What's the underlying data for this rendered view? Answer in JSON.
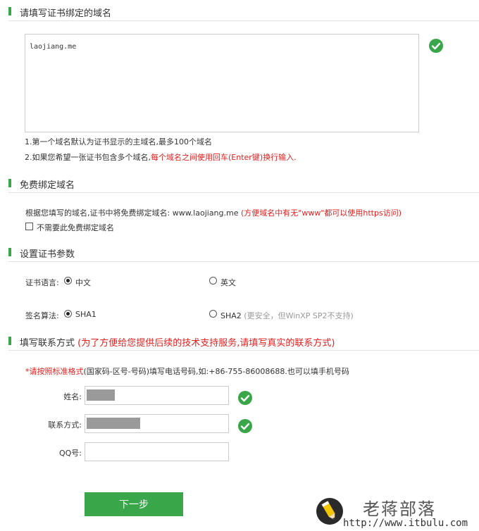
{
  "colors": {
    "accent": "#3aa64a",
    "alert": "#e02020"
  },
  "domain_section": {
    "title": "请填写证书绑定的域名",
    "domain_value": "laojiang.me",
    "valid_icon": "check-circle-icon",
    "hint1": "1.第一个域名默认为证书显示的主域名,最多100个域名",
    "hint2_prefix": "2.如果您希望一张证书包含多个域名,",
    "hint2_red": "每个域名之间使用回车(Enter键)换行输入."
  },
  "free_section": {
    "title": "免费绑定域名",
    "text_prefix": "根据您填写的域名,证书中将免费绑定域名: www.laojiang.me ",
    "text_red": "(方便域名中有无\"www\"都可以使用https访问)",
    "checkbox_label": "不需要此免费绑定域名",
    "checkbox_checked": false
  },
  "params_section": {
    "title": "设置证书参数",
    "language_label": "证书语言:",
    "language_options": [
      "中文",
      "英文"
    ],
    "language_selected": "中文",
    "algorithm_label": "签名算法:",
    "algorithm_options": [
      "SHA1",
      "SHA2"
    ],
    "algorithm_selected": "SHA1",
    "sha2_note": "(更安全，但WinXP SP2不支持)"
  },
  "contact_section": {
    "title": "填写联系方式",
    "title_note": "(为了方便给您提供后续的技术支持服务,请填写真实的联系方式)",
    "format_red": "*请按照标准格式",
    "format_text": "(国家码-区号-号码)填写电话号码,如:+86-755-86008688.也可以填手机号码",
    "name_label": "姓名:",
    "phone_label": "联系方式:",
    "qq_label": "QQ号:",
    "qq_value": ""
  },
  "next_button": "下一步",
  "watermark": {
    "logo_icon": "pencil-logo-icon",
    "title": "老蒋部落",
    "url": "http://www.itbulu.com"
  }
}
